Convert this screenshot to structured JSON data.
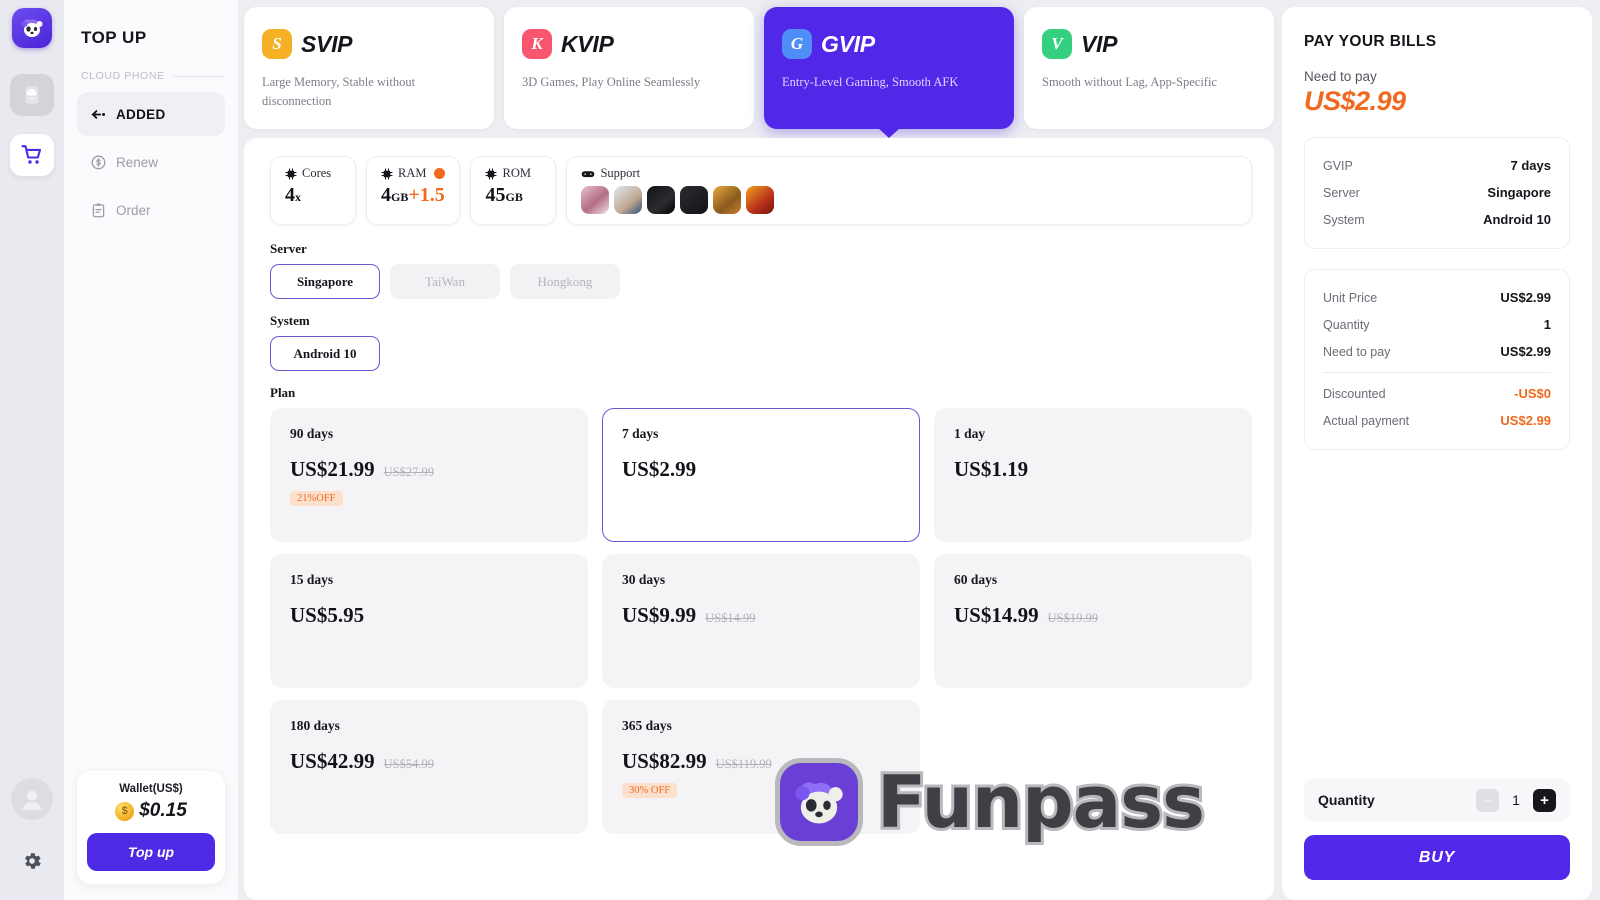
{
  "rail": {
    "logo_icon": "panda-logo-icon",
    "items": [
      {
        "icon": "cloud-phone-icon",
        "state": "inactive"
      },
      {
        "icon": "cart-icon",
        "state": "active"
      }
    ],
    "avatar_icon": "avatar-icon",
    "settings_icon": "gear-icon"
  },
  "sidebar": {
    "title": "TOP UP",
    "section_label": "CLOUD PHONE",
    "items": [
      {
        "label": "ADDED",
        "icon": "added-icon",
        "active": true
      },
      {
        "label": "Renew",
        "icon": "renew-icon",
        "active": false
      },
      {
        "label": "Order",
        "icon": "order-icon",
        "active": false
      }
    ],
    "wallet": {
      "title": "Wallet(US$)",
      "coin_icon": "coin-icon",
      "amount": "$0.15",
      "button": "Top up"
    }
  },
  "tiers": [
    {
      "key": "SVIP",
      "name": "SVIP",
      "letter": "S",
      "color": "#f5b025",
      "desc": "Large Memory, Stable without disconnection",
      "selected": false
    },
    {
      "key": "KVIP",
      "name": "KVIP",
      "letter": "K",
      "color": "#f8556f",
      "desc": "3D Games, Play Online Seamlessly",
      "selected": false
    },
    {
      "key": "GVIP",
      "name": "GVIP",
      "letter": "G",
      "color": "#4f8ef7",
      "desc": "Entry-Level Gaming, Smooth AFK",
      "selected": true
    },
    {
      "key": "VIP",
      "name": "VIP",
      "letter": "V",
      "color": "#35d07f",
      "desc": "Smooth without Lag, App-Specific",
      "selected": false
    }
  ],
  "specs": [
    {
      "icon": "chip-icon",
      "label": "Cores",
      "value": "4",
      "unit": "x",
      "extra": "",
      "badge": false
    },
    {
      "icon": "chip-icon",
      "label": "RAM",
      "value": "4",
      "unit": "GB",
      "extra": "+1.5",
      "badge": true
    },
    {
      "icon": "chip-icon",
      "label": "ROM",
      "value": "45",
      "unit": "GB",
      "extra": "",
      "badge": false
    }
  ],
  "support": {
    "icon": "gamepad-icon",
    "label": "Support",
    "games": [
      {
        "name": "game-thumb-1",
        "color": "linear-gradient(140deg,#e8c0cf,#b36d87 55%,#f1e2e6)"
      },
      {
        "name": "game-thumb-2",
        "color": "linear-gradient(140deg,#dfe7f4,#c0a88e 60%,#2b4f86)"
      },
      {
        "name": "game-thumb-3",
        "color": "linear-gradient(140deg,#111214,#2c2d31 60%,#000)"
      },
      {
        "name": "game-thumb-4",
        "color": "linear-gradient(140deg,#2b2c30,#121316)"
      },
      {
        "name": "game-thumb-5",
        "color": "linear-gradient(140deg,#e8a93c,#8a5a1e 60%,#c9802a)"
      },
      {
        "name": "game-thumb-6",
        "color": "linear-gradient(140deg,#f0a31f,#b8301a 60%,#7a1408)"
      }
    ]
  },
  "server": {
    "label": "Server",
    "options": [
      {
        "label": "Singapore",
        "selected": true
      },
      {
        "label": "TaiWan",
        "selected": false
      },
      {
        "label": "Hongkong",
        "selected": false
      }
    ]
  },
  "system": {
    "label": "System",
    "options": [
      {
        "label": "Android 10",
        "selected": true
      }
    ]
  },
  "plan": {
    "label": "Plan",
    "options": [
      {
        "duration": "90 days",
        "price": "US$21.99",
        "old_price": "US$27.99",
        "discount": "21%OFF",
        "selected": false
      },
      {
        "duration": "7 days",
        "price": "US$2.99",
        "old_price": "",
        "discount": "",
        "selected": true
      },
      {
        "duration": "1 day",
        "price": "US$1.19",
        "old_price": "",
        "discount": "",
        "selected": false
      },
      {
        "duration": "15 days",
        "price": "US$5.95",
        "old_price": "",
        "discount": "",
        "selected": false
      },
      {
        "duration": "30 days",
        "price": "US$9.99",
        "old_price": "US$14.99",
        "discount": "",
        "selected": false
      },
      {
        "duration": "60 days",
        "price": "US$14.99",
        "old_price": "US$19.99",
        "discount": "",
        "selected": false
      },
      {
        "duration": "180 days",
        "price": "US$42.99",
        "old_price": "US$54.99",
        "discount": "",
        "selected": false
      },
      {
        "duration": "365 days",
        "price": "US$82.99",
        "old_price": "US$119.99",
        "discount": "30% OFF",
        "selected": false
      }
    ]
  },
  "bill": {
    "title": "PAY YOUR BILLS",
    "need_label": "Need to pay",
    "need_amount": "US$2.99",
    "summary": [
      {
        "key": "GVIP",
        "value": "7 days"
      },
      {
        "key": "Server",
        "value": "Singapore"
      },
      {
        "key": "System",
        "value": "Android 10"
      }
    ],
    "totals": [
      {
        "key": "Unit Price",
        "value": "US$2.99",
        "orange": false
      },
      {
        "key": "Quantity",
        "value": "1",
        "orange": false
      },
      {
        "key": "Need to pay",
        "value": "US$2.99",
        "orange": false
      },
      {
        "key": "Discounted",
        "value": "-US$0",
        "orange": true
      },
      {
        "key": "Actual payment",
        "value": "US$2.99",
        "orange": true
      }
    ],
    "quantity_label": "Quantity",
    "quantity_value": "1",
    "minus_label": "–",
    "plus_label": "+",
    "buy_label": "BUY"
  },
  "watermark": {
    "text": "Funpass",
    "icon": "panda-logo-icon"
  },
  "colors": {
    "brand_purple": "#5128e8",
    "accent_orange": "#ef6a1e",
    "page_bg": "#edeef2"
  }
}
